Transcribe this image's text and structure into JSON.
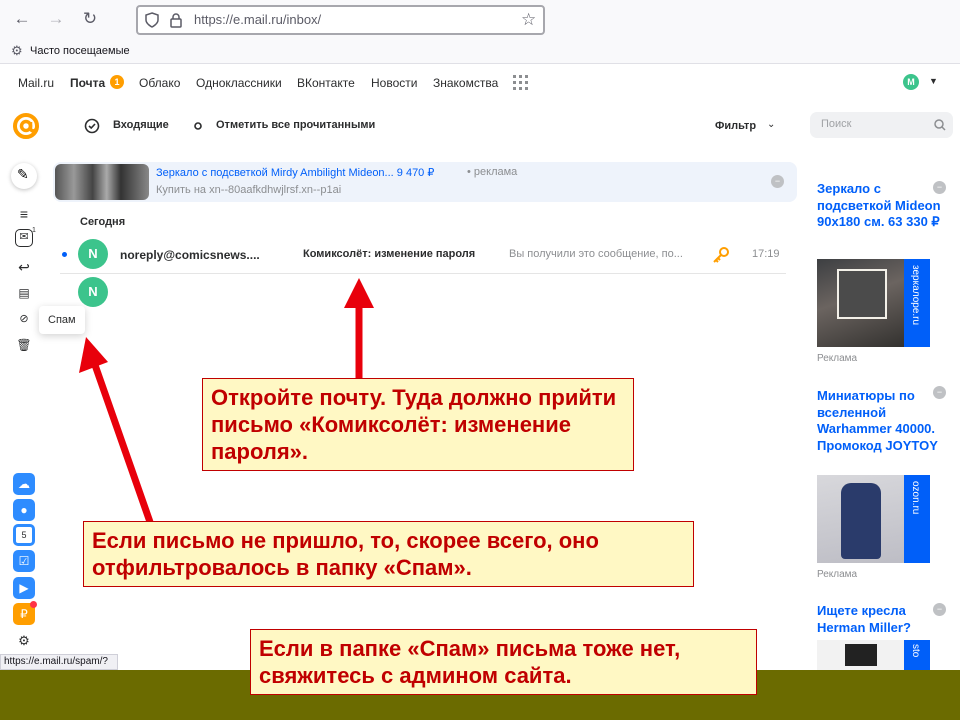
{
  "browser": {
    "url": "https://e.mail.ru/inbox/",
    "bookmark": "Часто посещаемые",
    "status_url": "https://e.mail.ru/spam/?"
  },
  "portal_nav": [
    "Mail.ru",
    "Почта",
    "Облако",
    "Одноклассники",
    "ВКонтакте",
    "Новости",
    "Знакомства"
  ],
  "mail_badge": "1",
  "user_initial": "M",
  "toolbar": {
    "inbox_label": "Входящие",
    "mark_all_label": "Отметить все прочитанными",
    "filter_label": "Фильтр",
    "search_placeholder": "Поиск"
  },
  "sidebar": {
    "unread_count": "1",
    "tooltip": "Спам",
    "calendar_day": "5"
  },
  "ad_banner": {
    "title": "Зеркало с подсветкой Mirdy Ambilight Mideon... 9 470 ₽",
    "tag": " • реклама",
    "link": "Купить на xn--80aafkdhwjlrsf.xn--p1ai"
  },
  "mail_list": {
    "date_header": "Сегодня",
    "items": [
      {
        "avatar": "N",
        "sender": "noreply@comicsnews....",
        "subject": "Комиксолёт: изменение пароля",
        "snippet": "Вы получили это сообщение, по...",
        "time": "17:19"
      }
    ],
    "second_avatar": "N"
  },
  "right_ads": [
    {
      "title": "Зеркало с подсветкой Mideon 90x180 см. 63 330 ₽",
      "side_text": "зеркалоpe.ru",
      "label": "Реклама"
    },
    {
      "title": "Миниатюры по вселенной Warhammer 40000. Промокод JOYTOY",
      "side_text": "ozon.ru",
      "label": "Реклама"
    },
    {
      "title": "Ищете кресла Herman Miller?",
      "side_text": "sto"
    }
  ],
  "callouts": {
    "open_mail": "Откройте почту. Туда должно прийти письмо «Комиксолёт: изменение пароля».",
    "check_spam": "Если письмо не пришло, то, скорее всего, оно отфильтровалось в папку «Спам».",
    "contact_admin": "Если в папке «Спам» письма тоже нет, свяжитесь с админом сайта."
  },
  "colors": {
    "accent": "#005ff9",
    "logo": "#ff9e00",
    "avatar": "#3cc48c",
    "callout_text": "#c00000",
    "callout_bg": "#fff8c4",
    "arrow": "#e8000b",
    "footer": "#6b6b00"
  }
}
